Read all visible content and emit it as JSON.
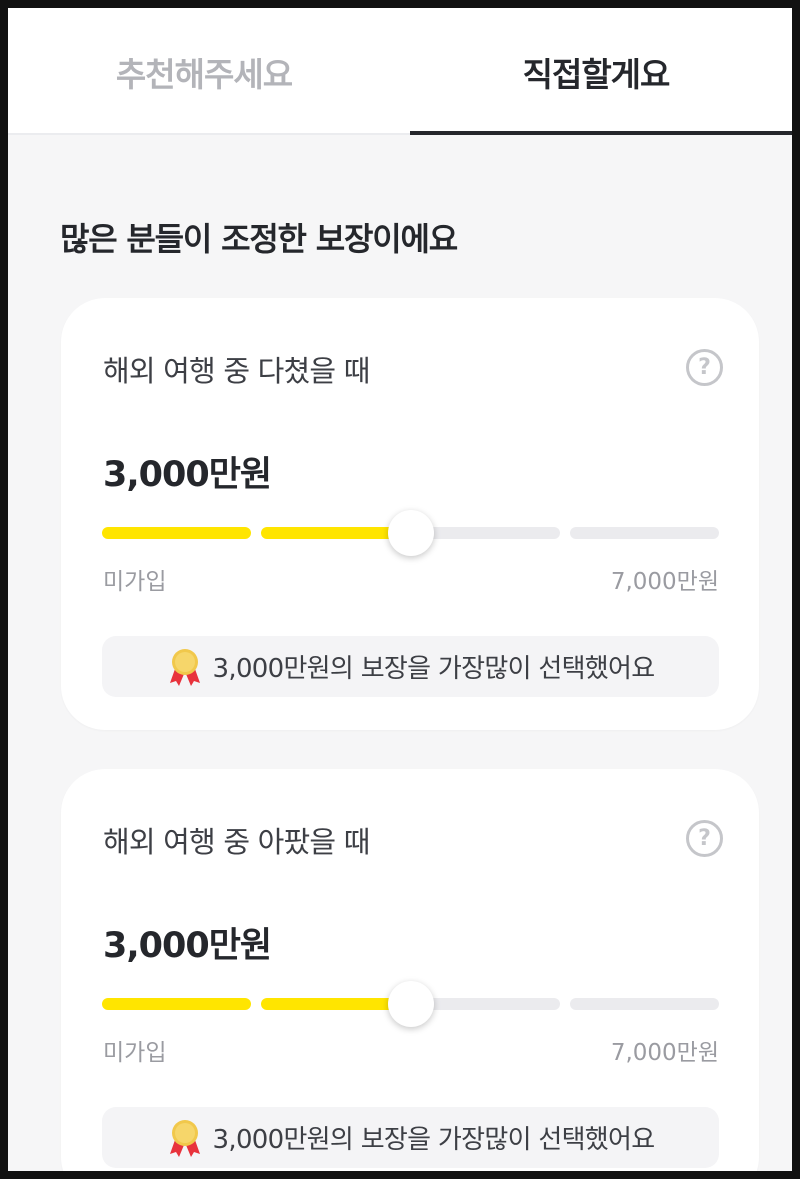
{
  "tabs": [
    {
      "label": "추천해주세요",
      "selected": false
    },
    {
      "label": "직접할게요",
      "selected": true
    }
  ],
  "section_title": "많은 분들이 조정한 보장이에요",
  "colors": {
    "accent_yellow": "#ffe500",
    "track_gray": "#ebebee",
    "text_dark": "#25272c",
    "text_muted": "#9a9ba1"
  },
  "cards": [
    {
      "title": "해외 여행 중 다쳤을 때",
      "amount": "3,000만원",
      "help_icon": "question-circle-icon",
      "slider": {
        "segments": 4,
        "value_fraction": 0.5
      },
      "range_min": "미가입",
      "range_max": "7,000만원",
      "tip_icon": "medal-icon",
      "tip_text": "3,000만원의 보장을 가장많이 선택했어요"
    },
    {
      "title": "해외 여행 중 아팠을 때",
      "amount": "3,000만원",
      "help_icon": "question-circle-icon",
      "slider": {
        "segments": 4,
        "value_fraction": 0.5
      },
      "range_min": "미가입",
      "range_max": "7,000만원",
      "tip_icon": "medal-icon",
      "tip_text": "3,000만원의 보장을 가장많이 선택했어요"
    }
  ]
}
